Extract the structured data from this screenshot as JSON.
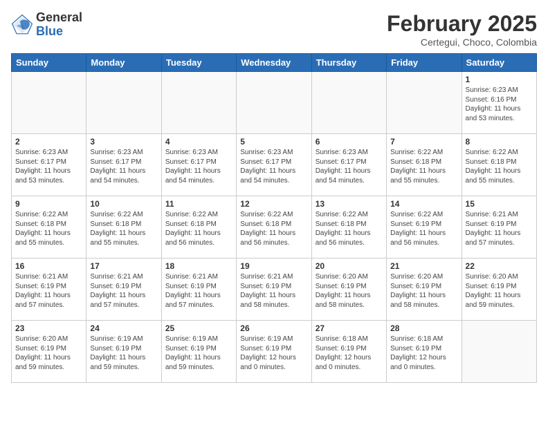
{
  "header": {
    "logo_general": "General",
    "logo_blue": "Blue",
    "month_year": "February 2025",
    "location": "Certegui, Choco, Colombia"
  },
  "weekdays": [
    "Sunday",
    "Monday",
    "Tuesday",
    "Wednesday",
    "Thursday",
    "Friday",
    "Saturday"
  ],
  "weeks": [
    [
      {
        "day": "",
        "info": ""
      },
      {
        "day": "",
        "info": ""
      },
      {
        "day": "",
        "info": ""
      },
      {
        "day": "",
        "info": ""
      },
      {
        "day": "",
        "info": ""
      },
      {
        "day": "",
        "info": ""
      },
      {
        "day": "1",
        "info": "Sunrise: 6:23 AM\nSunset: 6:16 PM\nDaylight: 11 hours\nand 53 minutes."
      }
    ],
    [
      {
        "day": "2",
        "info": "Sunrise: 6:23 AM\nSunset: 6:17 PM\nDaylight: 11 hours\nand 53 minutes."
      },
      {
        "day": "3",
        "info": "Sunrise: 6:23 AM\nSunset: 6:17 PM\nDaylight: 11 hours\nand 54 minutes."
      },
      {
        "day": "4",
        "info": "Sunrise: 6:23 AM\nSunset: 6:17 PM\nDaylight: 11 hours\nand 54 minutes."
      },
      {
        "day": "5",
        "info": "Sunrise: 6:23 AM\nSunset: 6:17 PM\nDaylight: 11 hours\nand 54 minutes."
      },
      {
        "day": "6",
        "info": "Sunrise: 6:23 AM\nSunset: 6:17 PM\nDaylight: 11 hours\nand 54 minutes."
      },
      {
        "day": "7",
        "info": "Sunrise: 6:22 AM\nSunset: 6:18 PM\nDaylight: 11 hours\nand 55 minutes."
      },
      {
        "day": "8",
        "info": "Sunrise: 6:22 AM\nSunset: 6:18 PM\nDaylight: 11 hours\nand 55 minutes."
      }
    ],
    [
      {
        "day": "9",
        "info": "Sunrise: 6:22 AM\nSunset: 6:18 PM\nDaylight: 11 hours\nand 55 minutes."
      },
      {
        "day": "10",
        "info": "Sunrise: 6:22 AM\nSunset: 6:18 PM\nDaylight: 11 hours\nand 55 minutes."
      },
      {
        "day": "11",
        "info": "Sunrise: 6:22 AM\nSunset: 6:18 PM\nDaylight: 11 hours\nand 56 minutes."
      },
      {
        "day": "12",
        "info": "Sunrise: 6:22 AM\nSunset: 6:18 PM\nDaylight: 11 hours\nand 56 minutes."
      },
      {
        "day": "13",
        "info": "Sunrise: 6:22 AM\nSunset: 6:18 PM\nDaylight: 11 hours\nand 56 minutes."
      },
      {
        "day": "14",
        "info": "Sunrise: 6:22 AM\nSunset: 6:19 PM\nDaylight: 11 hours\nand 56 minutes."
      },
      {
        "day": "15",
        "info": "Sunrise: 6:21 AM\nSunset: 6:19 PM\nDaylight: 11 hours\nand 57 minutes."
      }
    ],
    [
      {
        "day": "16",
        "info": "Sunrise: 6:21 AM\nSunset: 6:19 PM\nDaylight: 11 hours\nand 57 minutes."
      },
      {
        "day": "17",
        "info": "Sunrise: 6:21 AM\nSunset: 6:19 PM\nDaylight: 11 hours\nand 57 minutes."
      },
      {
        "day": "18",
        "info": "Sunrise: 6:21 AM\nSunset: 6:19 PM\nDaylight: 11 hours\nand 57 minutes."
      },
      {
        "day": "19",
        "info": "Sunrise: 6:21 AM\nSunset: 6:19 PM\nDaylight: 11 hours\nand 58 minutes."
      },
      {
        "day": "20",
        "info": "Sunrise: 6:20 AM\nSunset: 6:19 PM\nDaylight: 11 hours\nand 58 minutes."
      },
      {
        "day": "21",
        "info": "Sunrise: 6:20 AM\nSunset: 6:19 PM\nDaylight: 11 hours\nand 58 minutes."
      },
      {
        "day": "22",
        "info": "Sunrise: 6:20 AM\nSunset: 6:19 PM\nDaylight: 11 hours\nand 59 minutes."
      }
    ],
    [
      {
        "day": "23",
        "info": "Sunrise: 6:20 AM\nSunset: 6:19 PM\nDaylight: 11 hours\nand 59 minutes."
      },
      {
        "day": "24",
        "info": "Sunrise: 6:19 AM\nSunset: 6:19 PM\nDaylight: 11 hours\nand 59 minutes."
      },
      {
        "day": "25",
        "info": "Sunrise: 6:19 AM\nSunset: 6:19 PM\nDaylight: 11 hours\nand 59 minutes."
      },
      {
        "day": "26",
        "info": "Sunrise: 6:19 AM\nSunset: 6:19 PM\nDaylight: 12 hours\nand 0 minutes."
      },
      {
        "day": "27",
        "info": "Sunrise: 6:18 AM\nSunset: 6:19 PM\nDaylight: 12 hours\nand 0 minutes."
      },
      {
        "day": "28",
        "info": "Sunrise: 6:18 AM\nSunset: 6:19 PM\nDaylight: 12 hours\nand 0 minutes."
      },
      {
        "day": "",
        "info": ""
      }
    ]
  ]
}
